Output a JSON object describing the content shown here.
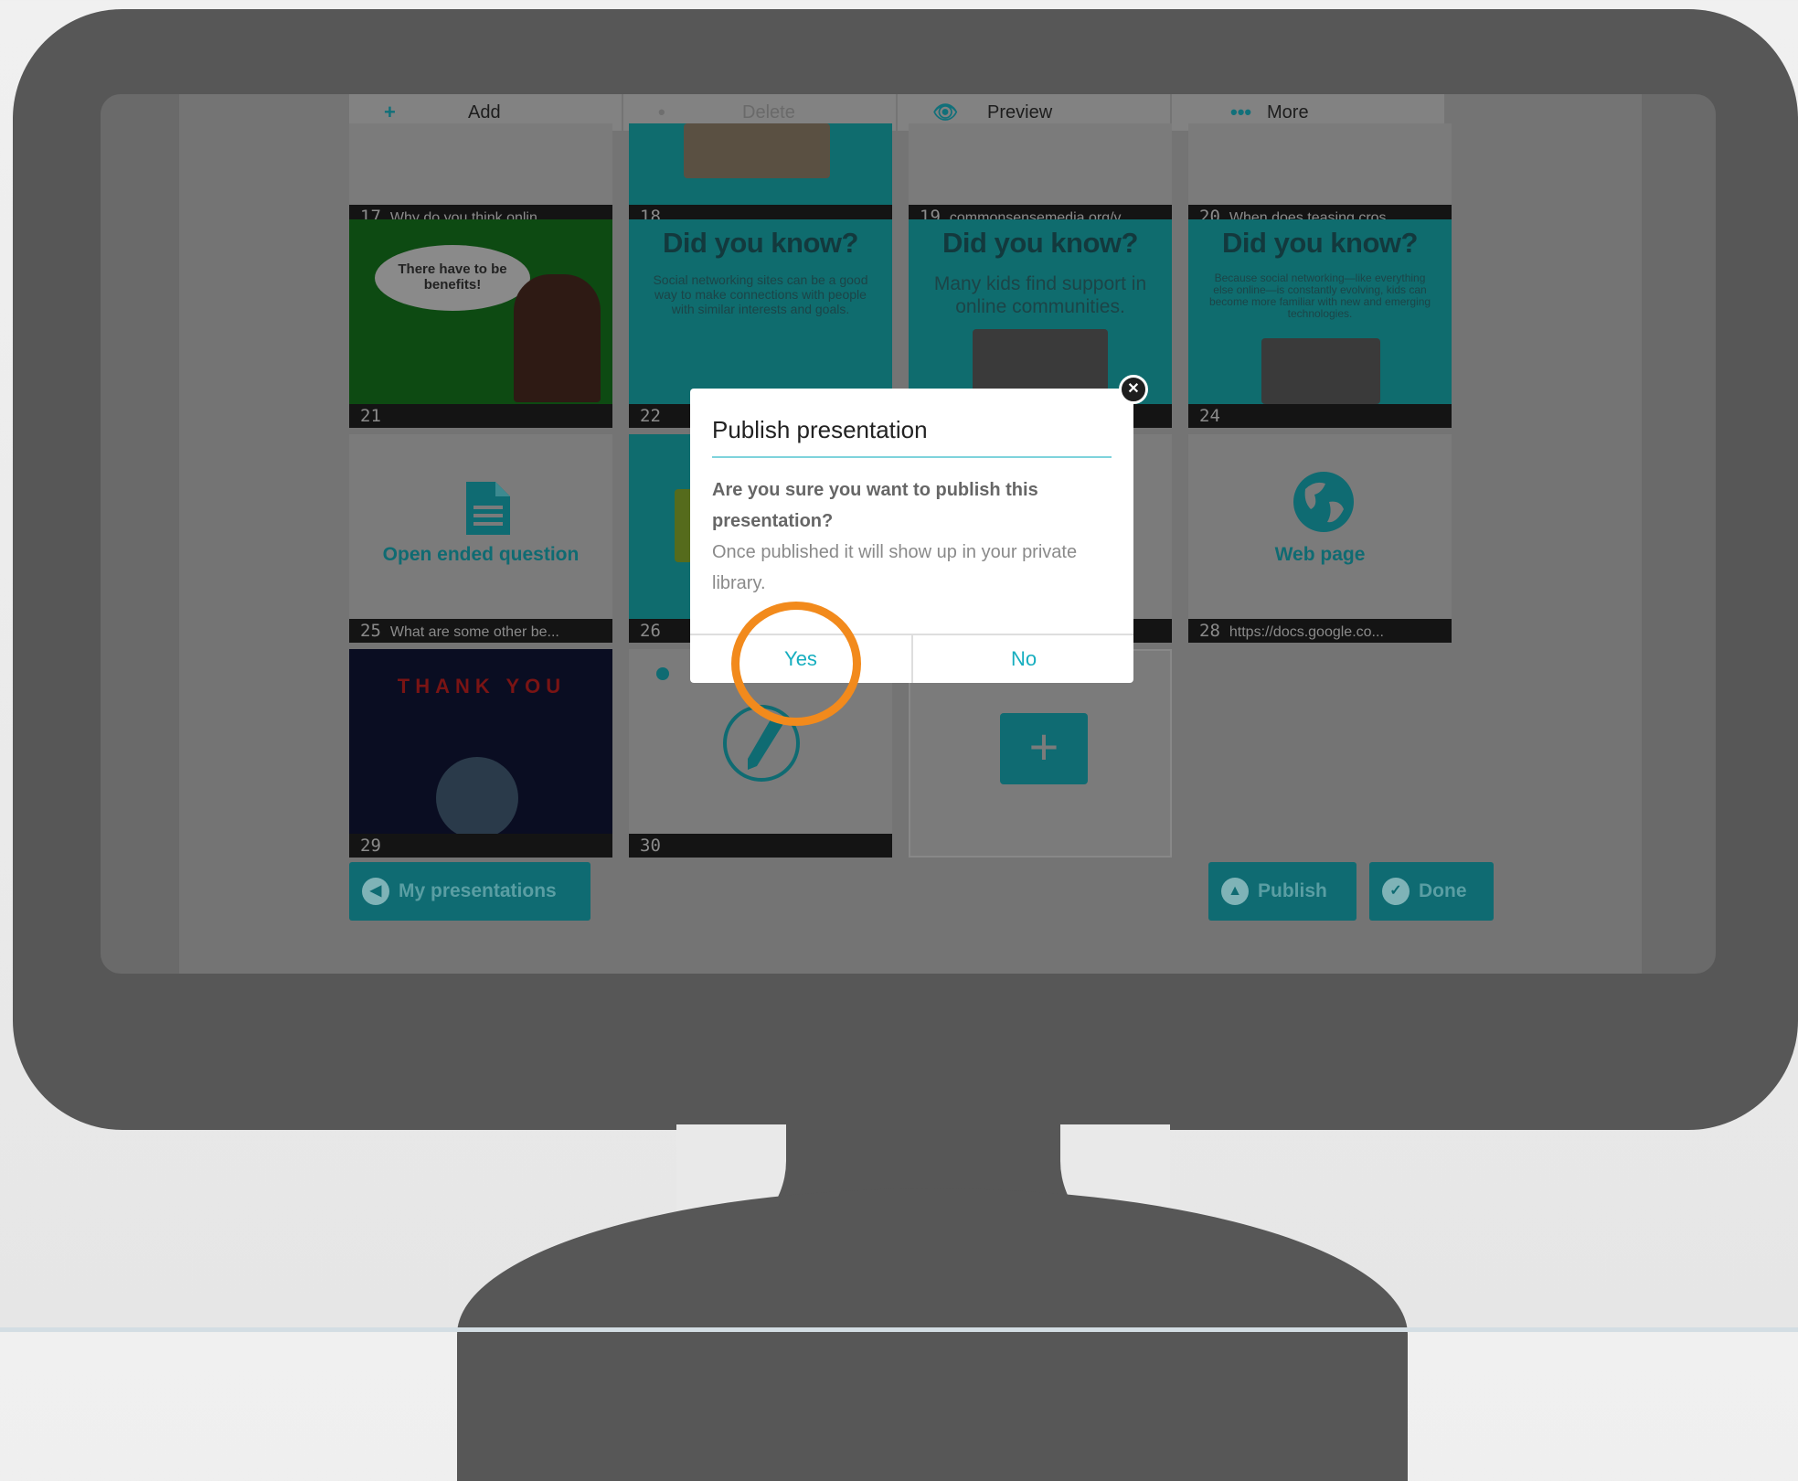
{
  "toolbar": {
    "add": "Add",
    "delete": "Delete",
    "preview": "Preview",
    "more": "More"
  },
  "icons": {
    "add": "+",
    "preview": "👁",
    "more": "•••",
    "close": "✕",
    "doc": "document-icon",
    "globe": "globe-icon",
    "pen": "pen-icon",
    "new_slide": "+"
  },
  "slides": {
    "s17": {
      "num": "17",
      "caption": "Why do you think onlin..."
    },
    "s18": {
      "num": "18",
      "caption": ""
    },
    "s19": {
      "num": "19",
      "caption": "commonsensemedia.org/v..."
    },
    "s20": {
      "num": "20",
      "caption": "When does teasing cros..."
    },
    "s21": {
      "num": "21",
      "bubble": "There have to be benefits!"
    },
    "s22": {
      "num": "22",
      "title": "Did you know?",
      "text": "Social networking sites can be a good way to make connections with people with similar interests and goals."
    },
    "s23": {
      "title": "Did you know?",
      "text": "Many kids find support in online communities."
    },
    "s24": {
      "num": "24",
      "title": "Did you know?",
      "text": "Because social networking—like everything else online—is constantly evolving, kids can become more familiar with new and emerging technologies."
    },
    "s25": {
      "num": "25",
      "label": "Open ended question",
      "caption": "What are some other be..."
    },
    "s26": {
      "num": "26"
    },
    "s28": {
      "num": "28",
      "label": "Web page",
      "caption": "https://docs.google.co..."
    },
    "s29": {
      "num": "29",
      "letters": "THANK YOU"
    },
    "s30": {
      "num": "30"
    }
  },
  "buttons": {
    "my_presentations": "My presentations",
    "publish": "Publish",
    "done": "Done"
  },
  "modal": {
    "title": "Publish presentation",
    "question": "Are you sure you want to publish this presentation?",
    "note": "Once published it will show up in your private library.",
    "yes": "Yes",
    "no": "No"
  },
  "colors": {
    "accent": "#16aebf",
    "highlight": "#f28a1c",
    "monitor": "#575757"
  }
}
